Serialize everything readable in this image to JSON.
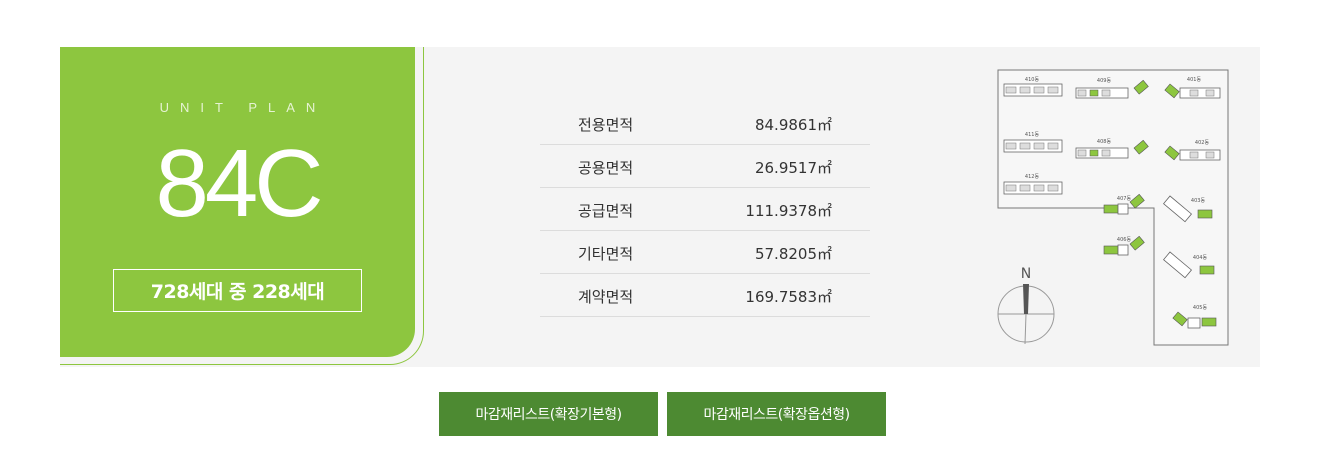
{
  "unit": {
    "label": "UNIT PLAN",
    "code": "84C",
    "households": "728세대 중 228세대"
  },
  "areas": [
    {
      "label": "전용면적",
      "value": "84.9861㎡"
    },
    {
      "label": "공용면적",
      "value": "26.9517㎡"
    },
    {
      "label": "공급면적",
      "value": "111.9378㎡"
    },
    {
      "label": "기타면적",
      "value": "57.8205㎡"
    },
    {
      "label": "계약면적",
      "value": "169.7583㎡"
    }
  ],
  "site_plan": {
    "compass_label": "N",
    "buildings": [
      "410동",
      "409동",
      "401동",
      "411동",
      "408동",
      "402동",
      "412동",
      "407동",
      "403동",
      "406동",
      "404동",
      "405동"
    ]
  },
  "buttons": {
    "basic": "마감재리스트(확장기본형)",
    "option": "마감재리스트(확장옵션형)"
  },
  "colors": {
    "accent_green": "#8dc63f",
    "button_green": "#4d8a32",
    "panel_bg": "#f4f4f4"
  }
}
